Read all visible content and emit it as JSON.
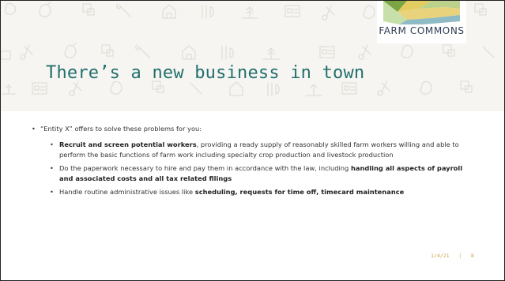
{
  "logo": {
    "text": "FARM COMMONS"
  },
  "slide": {
    "title": "There’s a new business in town"
  },
  "content": {
    "intro": "“Entity X” offers to solve these problems for you:",
    "points": [
      {
        "bold_before": "Recruit and screen potential workers",
        "text": ", providing a ready supply of reasonably skilled farm workers willing and able to perform the basic functions of farm work including specialty crop production and livestock production",
        "bold_after": ""
      },
      {
        "bold_before": "",
        "text": "Do the paperwork necessary to hire and pay them in accordance with the law, including ",
        "bold_after": "handling all aspects of payroll and associated costs and all tax related filings"
      },
      {
        "bold_before": "",
        "text": "Handle routine administrative issues like ",
        "bold_after": "scheduling, requests for time off, timecard maintenance"
      }
    ]
  },
  "footer": {
    "date": "1/4/21",
    "separator": "|",
    "page": "8"
  },
  "colors": {
    "title": "#22706e",
    "header_bg": "#f6f5f1",
    "footer": "#c9a64a",
    "logo_text": "#2d3e52"
  },
  "icons": [
    "chick-icon",
    "pig-icon",
    "wrench-icon",
    "barn-icon",
    "fork-knife-icon",
    "grain-icon",
    "id-card-icon",
    "tractor-icon"
  ]
}
